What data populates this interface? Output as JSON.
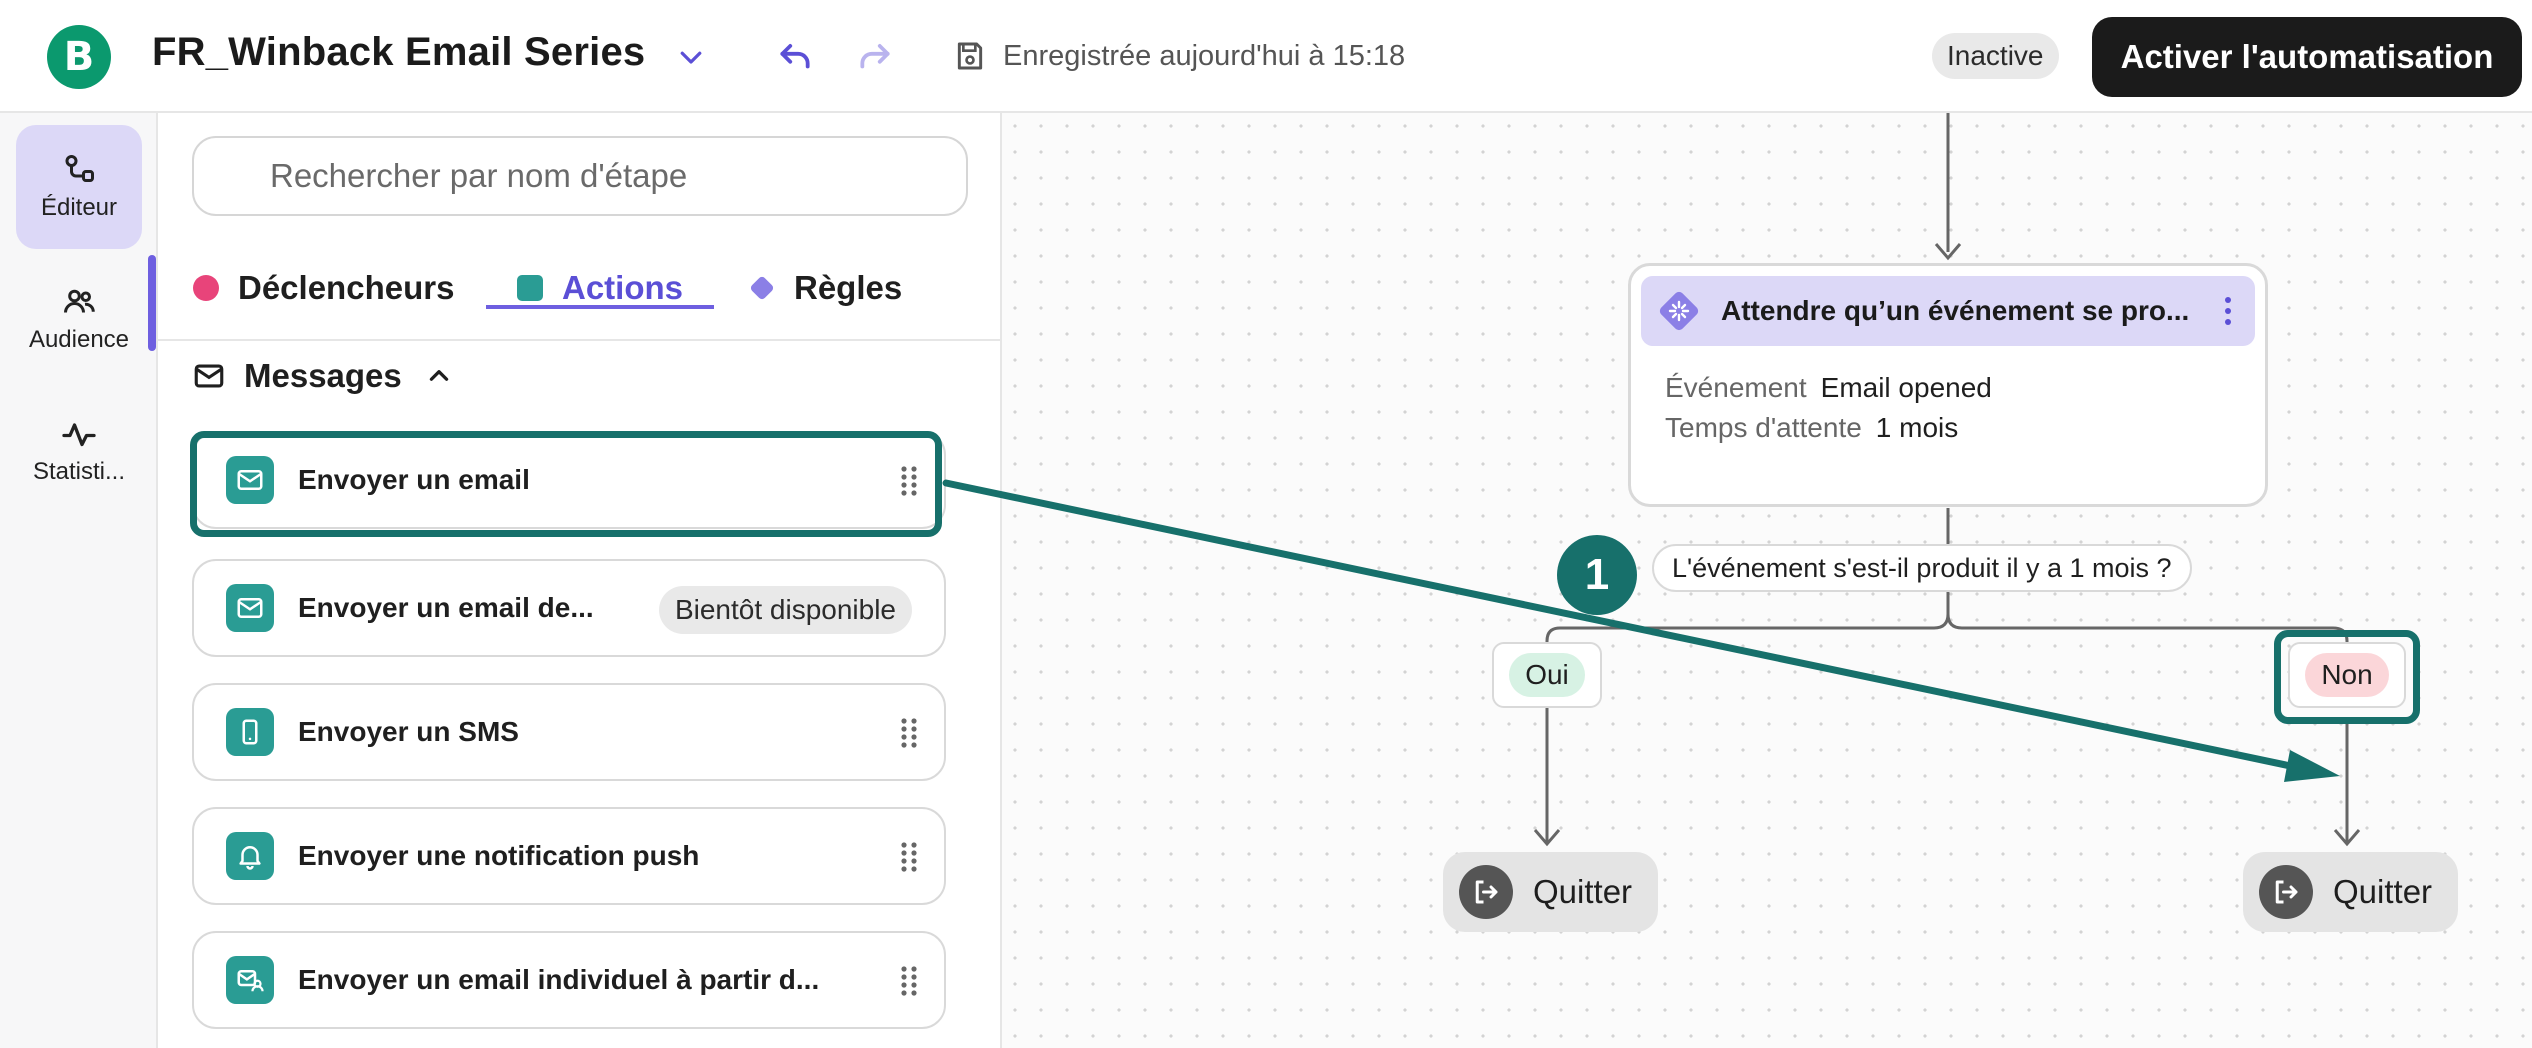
{
  "header": {
    "logo_letter": "B",
    "title": "FR_Winback Email Series",
    "saved_text": "Enregistrée aujourd'hui à 15:18",
    "status": "Inactive",
    "activate_label": "Activer l'automatisation"
  },
  "rail": {
    "items": [
      {
        "label": "Éditeur",
        "icon": "editor-icon"
      },
      {
        "label": "Audience",
        "icon": "audience-icon"
      },
      {
        "label": "Statisti...",
        "icon": "statistics-icon"
      }
    ]
  },
  "panel": {
    "search_placeholder": "Rechercher par nom d'étape",
    "tabs": [
      {
        "label": "Déclencheurs",
        "color": "#e8447a"
      },
      {
        "label": "Actions",
        "color": "#2a9c94"
      },
      {
        "label": "Règles",
        "color": "#8b7fe6"
      }
    ],
    "section_title": "Messages",
    "cards": [
      {
        "label": "Envoyer un email",
        "icon": "mail-icon"
      },
      {
        "label": "Envoyer un email de...",
        "icon": "mail-icon",
        "badge": "Bientôt disponible"
      },
      {
        "label": "Envoyer un SMS",
        "icon": "phone-icon"
      },
      {
        "label": "Envoyer une notification push",
        "icon": "bell-icon"
      },
      {
        "label": "Envoyer un email individuel à partir d...",
        "icon": "mail-user-icon"
      }
    ]
  },
  "canvas": {
    "node": {
      "title": "Attendre qu’un événement se pro...",
      "event_key": "Événement",
      "event_value": "Email opened",
      "wait_key": "Temps d'attente",
      "wait_value": "1 mois"
    },
    "step_number": "1",
    "question": "L'événement s'est-il produit il y a 1 mois  ?",
    "branch_yes": "Oui",
    "branch_no": "Non",
    "exit_label": "Quitter"
  },
  "colors": {
    "brand_green": "#0b996e",
    "accent_purple": "#6e5fe0",
    "teal": "#17706b",
    "action_teal": "#2a9c94"
  }
}
